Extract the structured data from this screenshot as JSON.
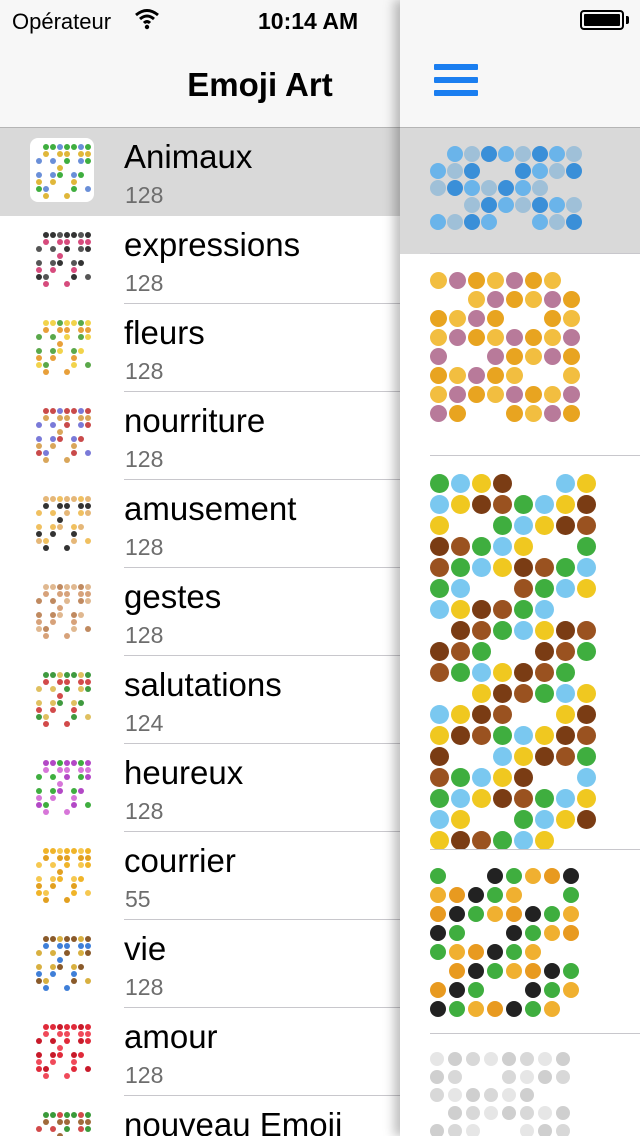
{
  "status_bar": {
    "carrier": "Opérateur",
    "time": "10:14 AM"
  },
  "nav": {
    "title": "Emoji Art",
    "menu_icon": "hamburger-icon"
  },
  "categories": [
    {
      "name": "Animaux",
      "count": "128",
      "selected": true
    },
    {
      "name": "expressions",
      "count": "128"
    },
    {
      "name": "fleurs",
      "count": "128"
    },
    {
      "name": "nourriture",
      "count": "128"
    },
    {
      "name": "amusement",
      "count": "128"
    },
    {
      "name": "gestes",
      "count": "128"
    },
    {
      "name": "salutations",
      "count": "124"
    },
    {
      "name": "heureux",
      "count": "128"
    },
    {
      "name": "courrier",
      "count": "55"
    },
    {
      "name": "vie",
      "count": "128"
    },
    {
      "name": "amour",
      "count": "128"
    },
    {
      "name": "nouveau Emoji",
      "count": ""
    }
  ],
  "colors": {
    "accent": "#1a7ef0",
    "selected_row": "#d9d9d9",
    "bar": "#f7f7f7",
    "count_text": "#6d6d6d"
  }
}
